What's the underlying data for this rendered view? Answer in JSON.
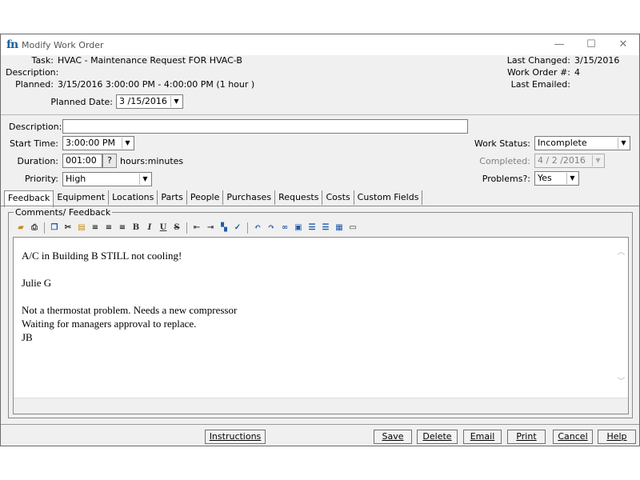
{
  "window": {
    "title": "Modify Work Order",
    "controls": {
      "minimize": "—",
      "maximize": "☐",
      "close": "✕"
    }
  },
  "header": {
    "task_label": "Task:",
    "task_value": "HVAC - Maintenance Request FOR HVAC-B",
    "description_label": "Description:",
    "planned_label": "Planned:",
    "planned_value": "3/15/2016 3:00:00 PM - 4:00:00 PM (1 hour )",
    "planned_date_label": "Planned Date:",
    "planned_date_value": "3 /15/2016",
    "last_changed_label": "Last Changed:",
    "last_changed_value": "3/15/2016",
    "work_order_label": "Work Order #:",
    "work_order_value": "4",
    "last_emailed_label": "Last Emailed:"
  },
  "form": {
    "description_label": "Description:",
    "description_value": "",
    "start_time_label": "Start Time:",
    "start_time_value": "3:00:00 PM",
    "duration_label": "Duration:",
    "duration_value": "001:00",
    "duration_help": "?",
    "duration_unit": "hours:minutes",
    "priority_label": "Priority:",
    "priority_value": "High",
    "work_status_label": "Work Status:",
    "work_status_value": "Incomplete",
    "completed_label": "Completed:",
    "completed_value": "4 / 2 /2016",
    "problems_label": "Problems?:",
    "problems_value": "Yes"
  },
  "tabs": [
    {
      "label": "Feedback",
      "active": true
    },
    {
      "label": "Equipment"
    },
    {
      "label": "Locations"
    },
    {
      "label": "Parts"
    },
    {
      "label": "People"
    },
    {
      "label": "Purchases"
    },
    {
      "label": "Requests"
    },
    {
      "label": "Costs"
    },
    {
      "label": "Custom Fields"
    }
  ],
  "comments": {
    "legend": "Comments/ Feedback",
    "lines": [
      "A/C in Building B STILL not cooling!",
      "",
      "Julie G",
      "",
      "Not a thermostat problem. Needs a new compressor",
      "Waiting for managers approval to replace.",
      "JB"
    ],
    "toolbar": {
      "bold": "B",
      "italic": "I",
      "underline": "U",
      "strike": "S"
    }
  },
  "buttons": {
    "instructions": "Instructions",
    "save": "Save",
    "delete": "Delete",
    "email": "Email",
    "print": "Print",
    "cancel": "Cancel",
    "help": "Help"
  }
}
